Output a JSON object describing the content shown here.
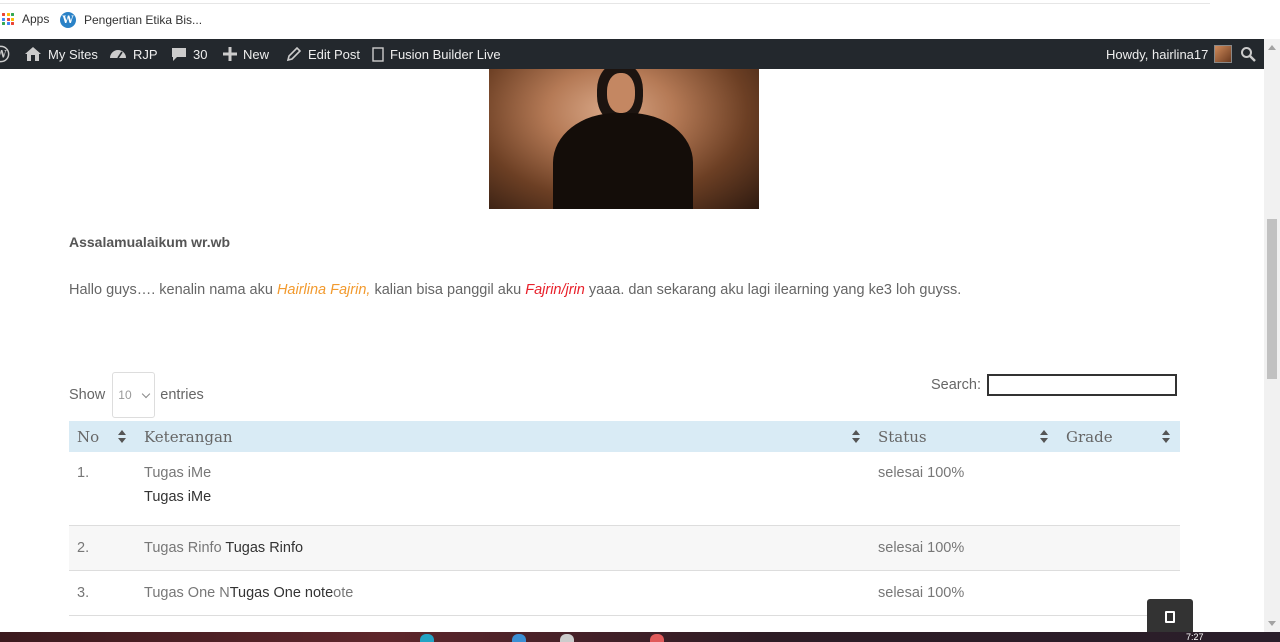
{
  "browser": {
    "bookmarks": [
      {
        "label": "Apps",
        "icon": "apps-grid-icon"
      },
      {
        "label": "Pengertian Etika Bis...",
        "icon": "wordpress-icon"
      }
    ]
  },
  "adminbar": {
    "items": [
      {
        "label": "My Sites",
        "icon": "my-sites-icon"
      },
      {
        "label": "RJP",
        "icon": "dashboard-icon"
      },
      {
        "label": "30",
        "icon": "comment-icon"
      },
      {
        "label": "New",
        "icon": "plus-icon"
      },
      {
        "label": "Edit Post",
        "icon": "pencil-icon"
      },
      {
        "label": "Fusion Builder Live",
        "icon": "square-icon"
      }
    ],
    "greeting": "Howdy, hairlina17"
  },
  "content": {
    "greeting": "Assalamualaikum wr.wb",
    "intro_1": "Hallo guys…. kenalin nama aku ",
    "intro_name": "Hairlina Fajrin,",
    "intro_2": " kalian bisa panggil aku ",
    "intro_nick": "Fajrin/jrin",
    "intro_3": " yaaa. dan sekarang aku lagi ilearning yang ke3 loh guyss."
  },
  "table_controls": {
    "show_label": "Show",
    "page_size": "10",
    "entries_label": "entries",
    "search_label": "Search:",
    "search_value": ""
  },
  "table": {
    "headers": [
      "No",
      "Keterangan",
      "Status",
      "Grade"
    ],
    "rows": [
      {
        "no": "1.",
        "ket_plain": "Tugas iMe",
        "ket_strong": "Tugas iMe",
        "status": "selesai 100%",
        "grade": ""
      },
      {
        "no": "2.",
        "ket_plain": "Tugas Rinfo ",
        "ket_strong": "Tugas Rinfo",
        "status": "selesai 100%",
        "grade": ""
      },
      {
        "no": "3.",
        "ket_plain_a": "Tugas One N",
        "ket_strong": "Tugas One note",
        "ket_plain_b": "ote",
        "status": "selesai 100%",
        "grade": ""
      }
    ]
  },
  "taskbar": {
    "clock": "7:27"
  },
  "colors": {
    "adminbar": "#23282d",
    "table_header": "#d9ebf5",
    "name_orange": "#f29a2e",
    "nick_red": "#e8202a"
  }
}
